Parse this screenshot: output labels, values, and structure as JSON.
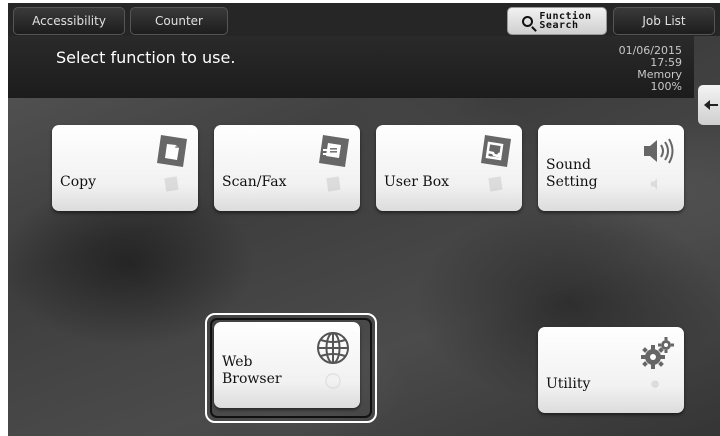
{
  "topbar": {
    "accessibility": "Accessibility",
    "counter": "Counter",
    "function_search_line1": "Function",
    "function_search_line2": "Search",
    "job_list": "Job List"
  },
  "header": {
    "title": "Select function to use.",
    "date": "01/06/2015",
    "time": "17:59",
    "memory_label": "Memory",
    "memory_value": "100%"
  },
  "tiles": {
    "copy": {
      "label": "Copy",
      "icon": "copy-icon"
    },
    "scan_fax": {
      "label": "Scan/Fax",
      "icon": "scan-fax-icon"
    },
    "user_box": {
      "label": "User Box",
      "icon": "user-box-icon"
    },
    "sound_setting": {
      "label": "Sound\nSetting",
      "icon": "speaker-icon"
    },
    "web_browser": {
      "label": "Web\nBrowser",
      "icon": "globe-icon"
    },
    "utility": {
      "label": "Utility",
      "icon": "gears-icon"
    }
  },
  "colors": {
    "topbar_bg": "#262626",
    "header_bg": "#1c1c1c",
    "tile_bg": "#f4f4f4",
    "icon_gray": "#666666"
  }
}
